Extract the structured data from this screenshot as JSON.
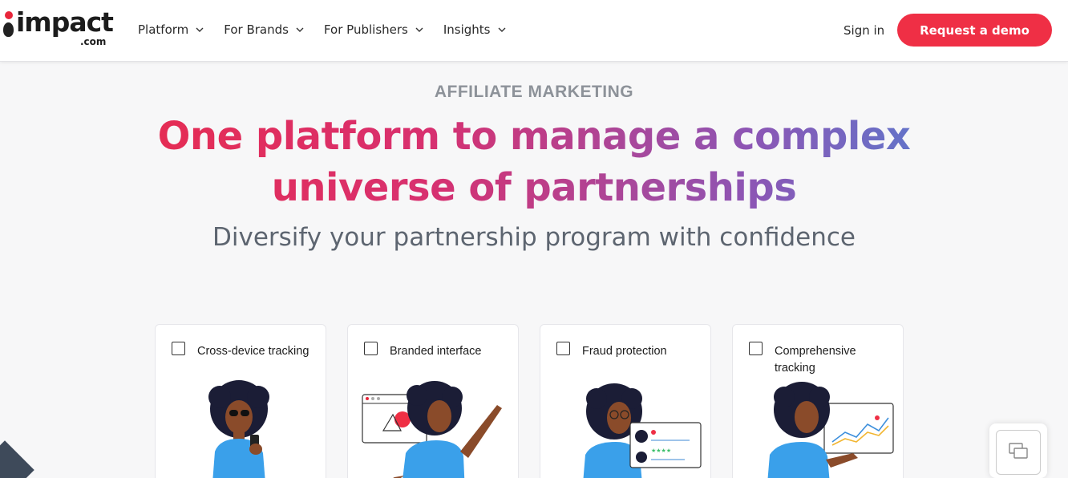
{
  "header": {
    "logo_text": "impact",
    "logo_sub": ".com",
    "nav": [
      {
        "label": "Platform",
        "icon": "chevron-down-icon"
      },
      {
        "label": "For Brands",
        "icon": "chevron-down-icon"
      },
      {
        "label": "For Publishers",
        "icon": "chevron-down-icon"
      },
      {
        "label": "Insights",
        "icon": "chevron-down-icon"
      }
    ],
    "sign_in": "Sign in",
    "demo_button": "Request a demo"
  },
  "hero": {
    "eyebrow": "AFFILIATE MARKETING",
    "headline_line1": "One platform to manage a complex",
    "headline_line2": "universe of partnerships",
    "subhead": "Diversify your partnership program with confidence"
  },
  "cards": [
    {
      "label": "Cross-device tracking",
      "checked": false
    },
    {
      "label": "Branded interface",
      "checked": false
    },
    {
      "label": "Fraud protection",
      "checked": false
    },
    {
      "label": "Comprehensive tracking",
      "checked": false
    }
  ],
  "colors": {
    "accent": "#ef2f45",
    "gradient_start": "#ec2b45",
    "gradient_mid": "#8d55b4",
    "gradient_end": "#3d8fdc",
    "shirt": "#3aa0ea",
    "skin": "#8a4b2a",
    "hair": "#1b1d36"
  }
}
